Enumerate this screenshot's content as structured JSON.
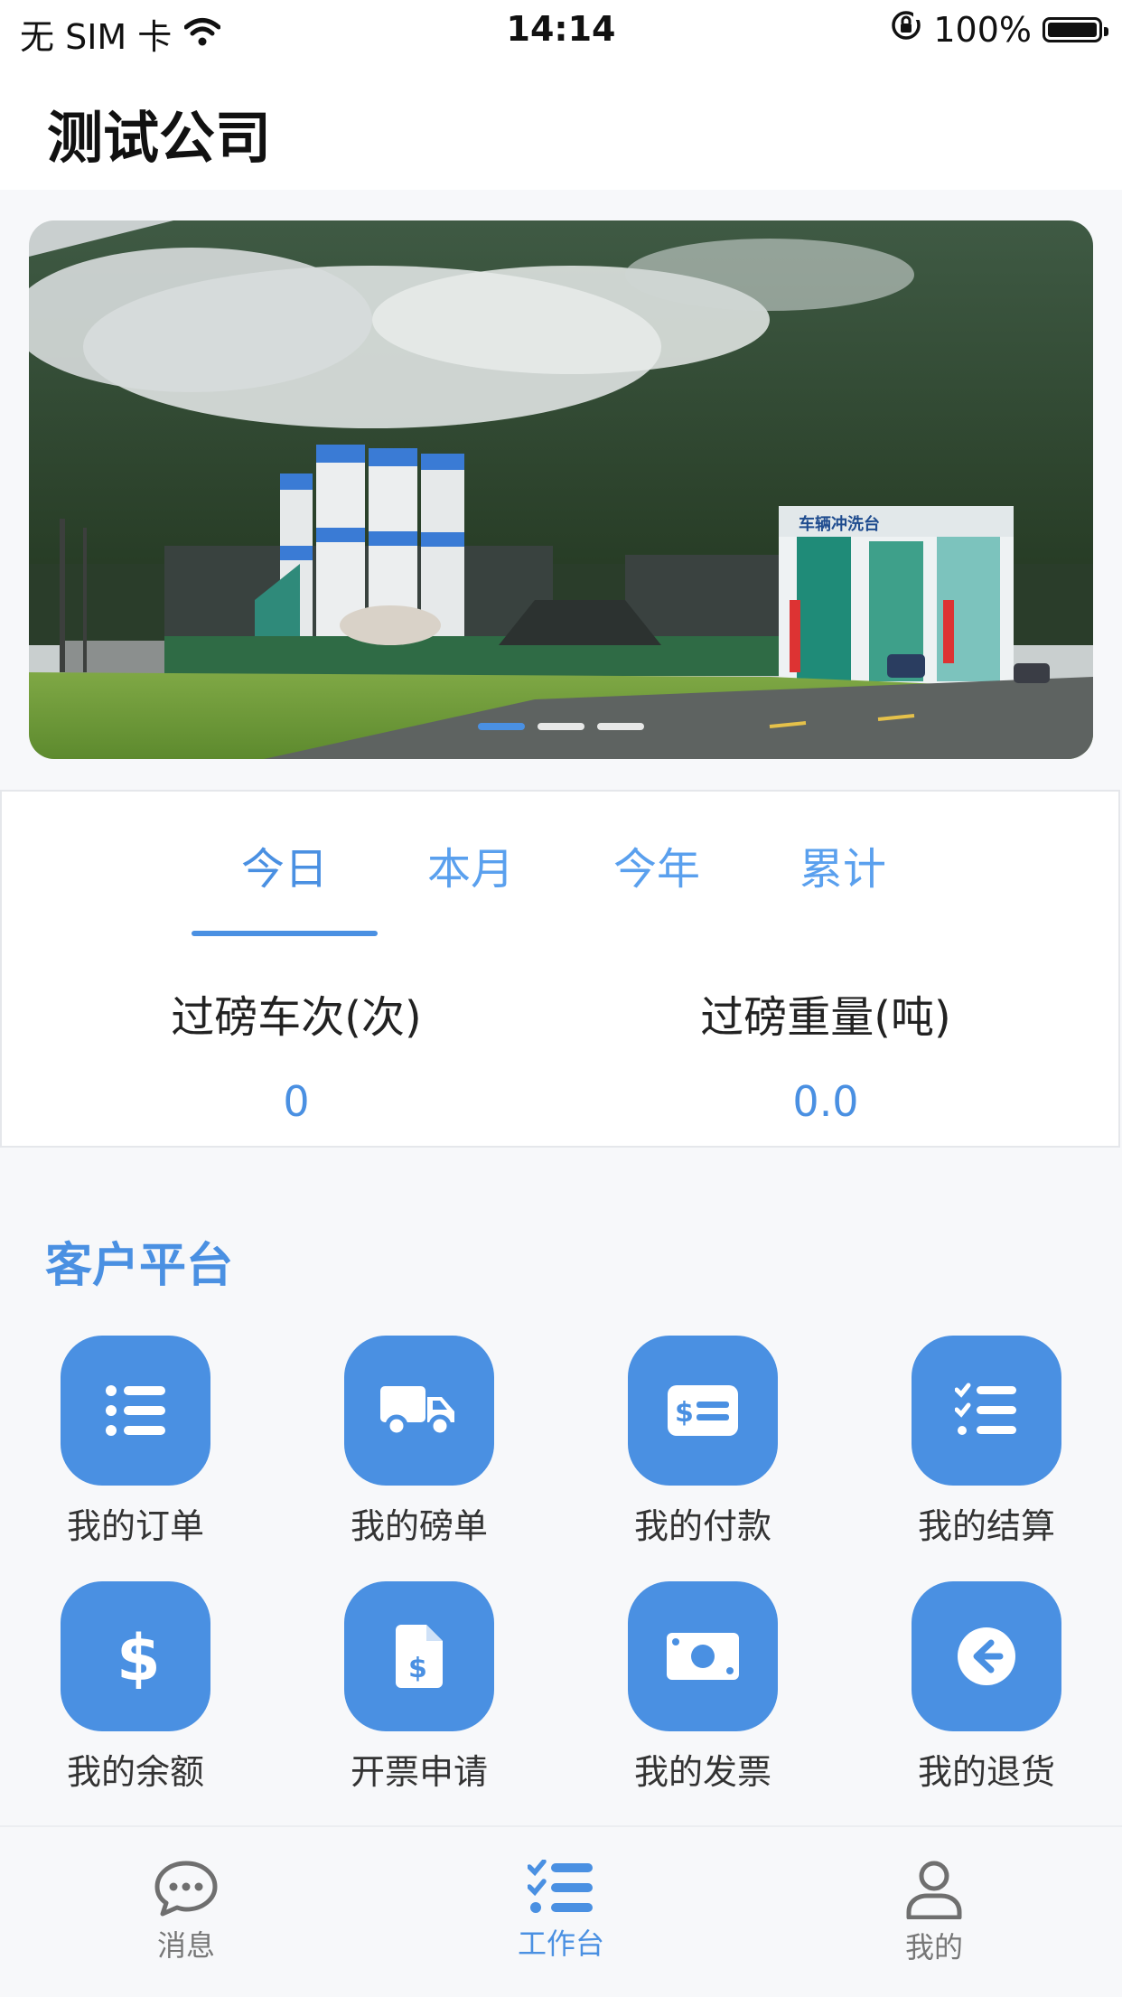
{
  "status_bar": {
    "carrier": "无 SIM 卡",
    "time": "14:14",
    "battery": "100%"
  },
  "header": {
    "title": "测试公司"
  },
  "banner": {
    "slide_count": 3,
    "active_slide": 1,
    "signboard_text": "车辆冲洗台"
  },
  "stats": {
    "tabs": [
      "今日",
      "本月",
      "今年",
      "累计"
    ],
    "active_tab": 0,
    "items": [
      {
        "label": "过磅车次(次)",
        "value": "0"
      },
      {
        "label": "过磅重量(吨)",
        "value": "0.0"
      }
    ]
  },
  "platform": {
    "title": "客户平台",
    "items": [
      {
        "label": "我的订单",
        "icon": "list-icon"
      },
      {
        "label": "我的磅单",
        "icon": "truck-icon"
      },
      {
        "label": "我的付款",
        "icon": "money-check-icon"
      },
      {
        "label": "我的结算",
        "icon": "checklist-icon"
      },
      {
        "label": "我的余额",
        "icon": "dollar-icon"
      },
      {
        "label": "开票申请",
        "icon": "invoice-dollar-icon"
      },
      {
        "label": "我的发票",
        "icon": "money-bill-icon"
      },
      {
        "label": "我的退货",
        "icon": "arrow-circle-left-icon"
      }
    ]
  },
  "tabbar": {
    "items": [
      {
        "label": "消息",
        "icon": "chat-icon"
      },
      {
        "label": "工作台",
        "icon": "tasks-icon"
      },
      {
        "label": "我的",
        "icon": "user-icon"
      }
    ],
    "active": 1
  },
  "colors": {
    "accent": "#4a90e2",
    "background": "#f7f8fa"
  }
}
